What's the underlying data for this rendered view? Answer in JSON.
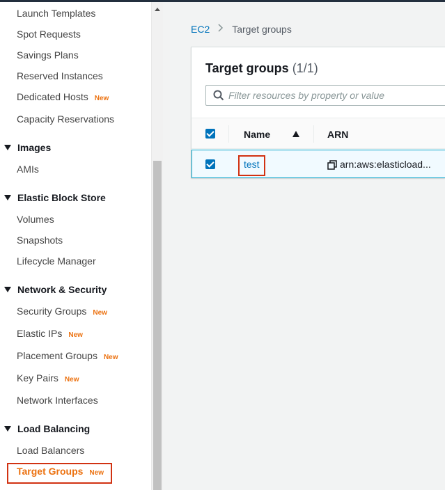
{
  "sidebar": {
    "items": [
      {
        "label": "Launch Templates"
      },
      {
        "label": "Spot Requests"
      },
      {
        "label": "Savings Plans"
      },
      {
        "label": "Reserved Instances"
      },
      {
        "label": "Dedicated Hosts",
        "badge": "New"
      },
      {
        "label": "Capacity Reservations"
      }
    ],
    "sections": {
      "images": {
        "title": "Images",
        "items": [
          {
            "label": "AMIs"
          }
        ]
      },
      "ebs": {
        "title": "Elastic Block Store",
        "items": [
          {
            "label": "Volumes"
          },
          {
            "label": "Snapshots"
          },
          {
            "label": "Lifecycle Manager"
          }
        ]
      },
      "network": {
        "title": "Network & Security",
        "items": [
          {
            "label": "Security Groups",
            "badge": "New"
          },
          {
            "label": "Elastic IPs",
            "badge": "New"
          },
          {
            "label": "Placement Groups",
            "badge": "New"
          },
          {
            "label": "Key Pairs",
            "badge": "New"
          },
          {
            "label": "Network Interfaces"
          }
        ]
      },
      "lb": {
        "title": "Load Balancing",
        "items": [
          {
            "label": "Load Balancers"
          },
          {
            "label": "Target Groups",
            "badge": "New",
            "active": true
          }
        ]
      }
    }
  },
  "breadcrumb": {
    "root": "EC2",
    "separator": ">",
    "current": "Target groups"
  },
  "panel": {
    "title": "Target groups",
    "count": "(1/1)",
    "search_placeholder": "Filter resources by property or value",
    "columns": {
      "name": "Name",
      "arn": "ARN"
    },
    "rows": [
      {
        "name": "test",
        "arn": "arn:aws:elasticload..."
      }
    ]
  },
  "colors": {
    "accent": "#ec7211",
    "link": "#0073bb",
    "highlight": "#d13212",
    "selected_row": "#f1faff"
  }
}
